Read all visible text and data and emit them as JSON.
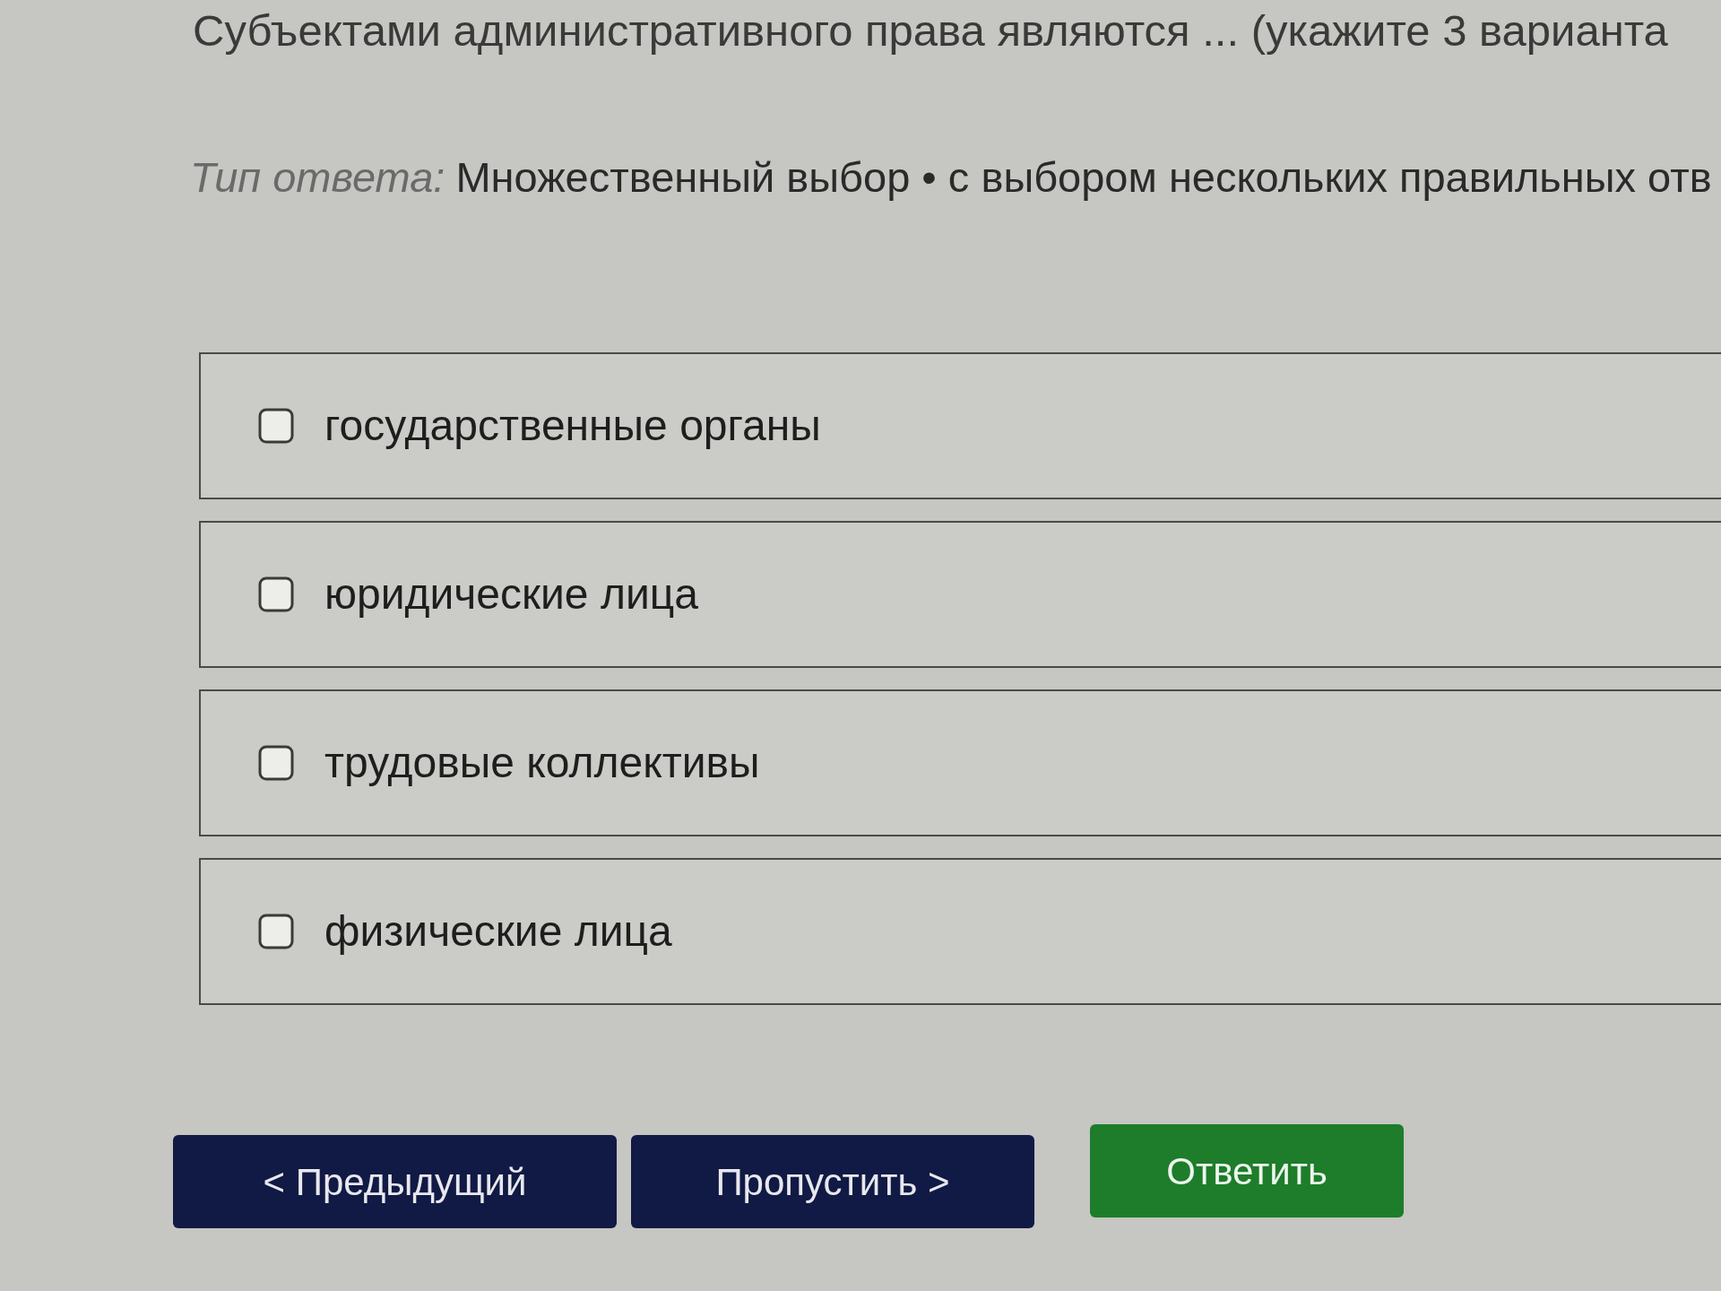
{
  "question": {
    "text": "Субъектами административного права являются ... (укажите 3 варианта"
  },
  "answer_type": {
    "label": "Тип ответа:",
    "value": "Множественный выбор • с выбором нескольких правильных отв"
  },
  "options": [
    {
      "label": "государственные органы",
      "checked": false
    },
    {
      "label": "юридические лица",
      "checked": false
    },
    {
      "label": "трудовые коллективы",
      "checked": false
    },
    {
      "label": "физические лица",
      "checked": false
    }
  ],
  "buttons": [
    {
      "label": "< Предыдущий",
      "kind": "secondary"
    },
    {
      "label": "Пропустить >",
      "kind": "secondary"
    },
    {
      "label": "Ответить",
      "kind": "primary"
    }
  ]
}
